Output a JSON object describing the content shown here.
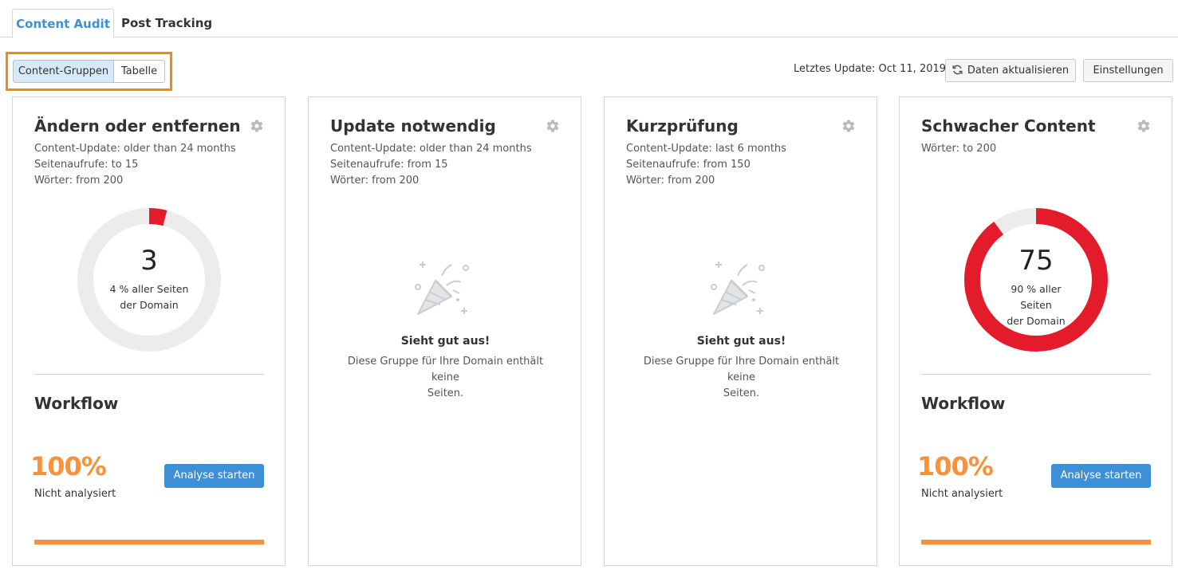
{
  "tabs": [
    {
      "label": "Content Audit",
      "active": true
    },
    {
      "label": "Post Tracking",
      "active": false
    }
  ],
  "view_toggle": {
    "options": [
      "Content-Gruppen",
      "Tabelle"
    ],
    "selected": "Content-Gruppen"
  },
  "toolbar": {
    "last_update": "Letztes Update: Oct 11, 2019",
    "refresh_label": "Daten aktualisieren",
    "settings_label": "Einstellungen"
  },
  "colors": {
    "accent_blue": "#3d8fd6",
    "orange": "#f7913a",
    "red": "#e41b2b",
    "highlight_border": "#f7870f"
  },
  "cards": [
    {
      "title": "Ändern oder entfernen",
      "meta": [
        "Content-Update: older than 24 months",
        "Seitenaufrufe: to 15",
        "Wörter: from 200"
      ],
      "donut": {
        "value": "3",
        "percent": 4,
        "label_line1": "4 % aller Seiten",
        "label_line2": "der Domain"
      },
      "workflow": {
        "title": "Workflow",
        "percent_label": "100%",
        "status": "Nicht analysiert",
        "button": "Analyse starten",
        "progress": 1.0
      }
    },
    {
      "title": "Update notwendig",
      "meta": [
        "Content-Update: older than 24 months",
        "Seitenaufrufe: from 15",
        "Wörter: from 200"
      ],
      "empty": {
        "title": "Sieht gut aus!",
        "desc_line1": "Diese Gruppe für Ihre Domain enthält keine",
        "desc_line2": "Seiten."
      }
    },
    {
      "title": "Kurzprüfung",
      "meta": [
        "Content-Update: last 6 months",
        "Seitenaufrufe: from 150",
        "Wörter: from 200"
      ],
      "empty": {
        "title": "Sieht gut aus!",
        "desc_line1": "Diese Gruppe für Ihre Domain enthält keine",
        "desc_line2": "Seiten."
      }
    },
    {
      "title": "Schwacher Content",
      "meta": [
        "Wörter: to 200"
      ],
      "donut": {
        "value": "75",
        "percent": 90,
        "label_line1": "90 % aller Seiten",
        "label_line2": "der Domain"
      },
      "workflow": {
        "title": "Workflow",
        "percent_label": "100%",
        "status": "Nicht analysiert",
        "button": "Analyse starten",
        "progress": 1.0
      }
    }
  ]
}
